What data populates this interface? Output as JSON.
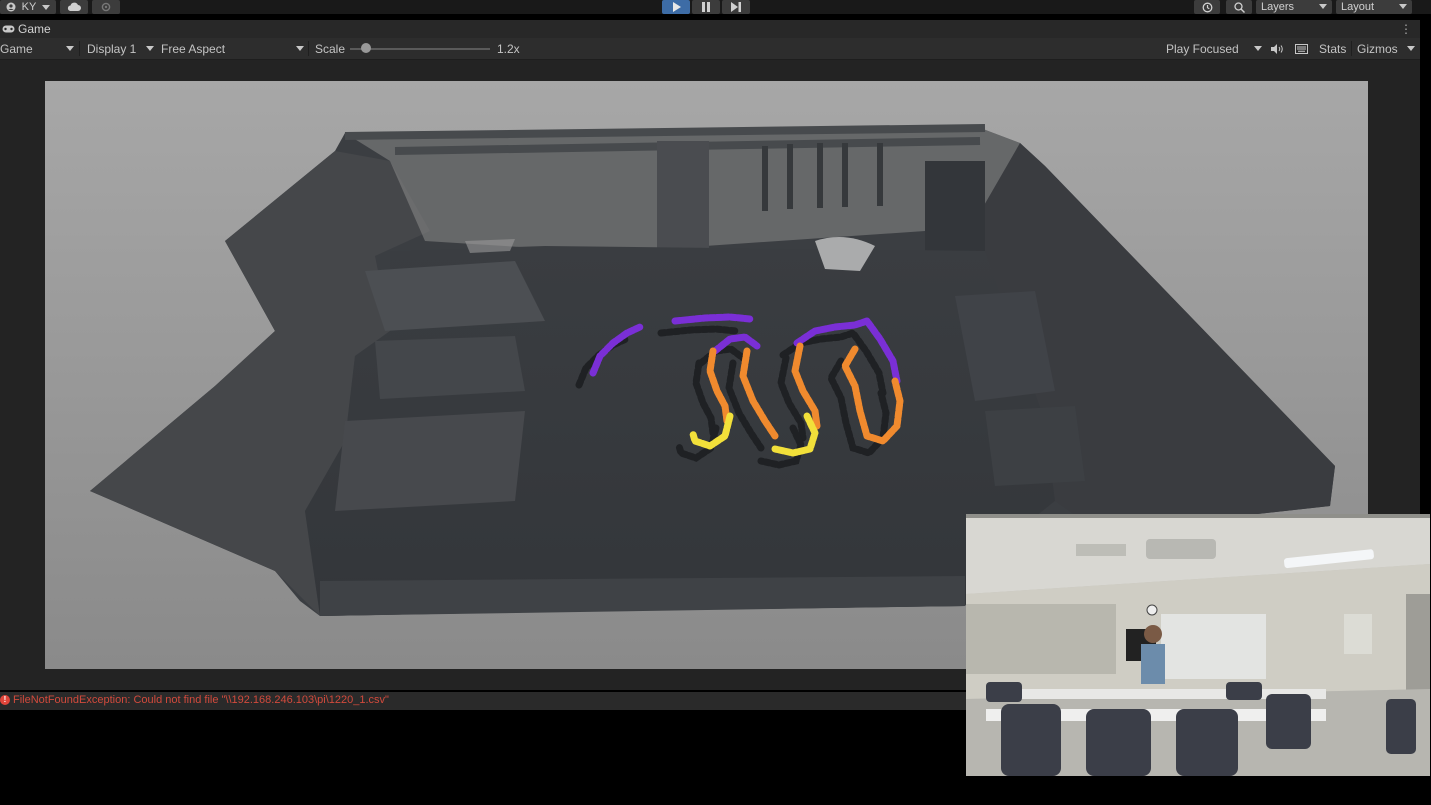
{
  "toolbar": {
    "account_label": "KY",
    "layers_label": "Layers",
    "layout_label": "Layout",
    "play_active": true
  },
  "tabs": {
    "game_tab_label": "Game"
  },
  "game_bar": {
    "view_mode": "Game",
    "display": "Display 1",
    "aspect": "Free Aspect",
    "scale_label": "Scale",
    "scale_value": "1.2x",
    "play_mode": "Play Focused",
    "stats_label": "Stats",
    "gizmos_label": "Gizmos"
  },
  "console": {
    "error_message": "FileNotFoundException: Could not find file \"\\\\192.168.246.103\\pi\\1220_1.csv\""
  },
  "colors": {
    "play_active": "#3d6ca6",
    "trace_purple": "#7a2fd6",
    "trace_orange": "#f08a2e",
    "trace_yellow": "#f2e03a",
    "error_red": "#d24a3c"
  }
}
